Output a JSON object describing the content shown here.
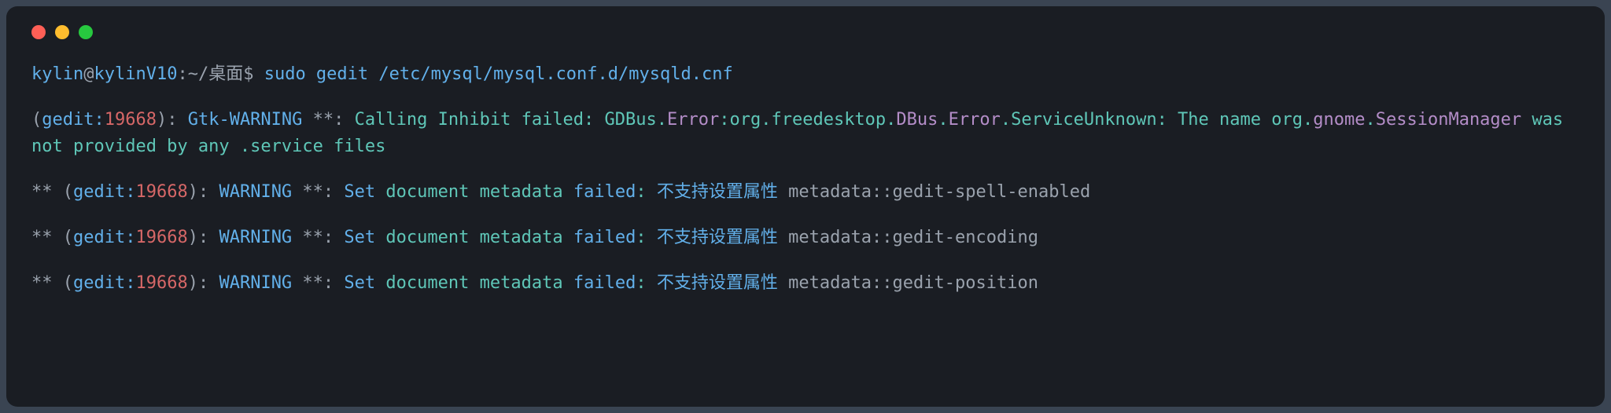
{
  "prompt": {
    "user": "kylin",
    "at": "@",
    "host": "kylinV10",
    "colon": ":",
    "path": "~/桌面",
    "dollar": "$",
    "command": "sudo gedit /etc/mysql/mysql.conf.d/mysqld.cnf"
  },
  "gtk_warning": {
    "open": "(",
    "gedit": "gedit:",
    "pid": "19668",
    "close": "):",
    "type": " Gtk-WARNING",
    "stars": " **: ",
    "msg_a": "Calling Inhibit failed: GDBus.",
    "err1": "Error",
    "msg_b": ":org.freedesktop.",
    "dbus": "DBus",
    "dot1": ".",
    "err2": "Error",
    "msg_c": ".ServiceUnknown: The name org.",
    "gnome": "gnome",
    "dot2": ".",
    "sess": "SessionManager",
    "msg_d": " was not provided by any .service files"
  },
  "warnings": [
    {
      "stars": "** ",
      "open": "(",
      "gedit": "gedit:",
      "pid": "19668",
      "close": "):",
      "type": " WARNING",
      "stars2": " **: ",
      "a": "Set",
      "b": " document metadata ",
      "c": "failed",
      "d": ": ",
      "cn": "不支持设置属性",
      "e": " metadata::gedit-spell-enabled"
    },
    {
      "stars": "** ",
      "open": "(",
      "gedit": "gedit:",
      "pid": "19668",
      "close": "):",
      "type": " WARNING",
      "stars2": " **: ",
      "a": "Set",
      "b": " document metadata ",
      "c": "failed",
      "d": ": ",
      "cn": "不支持设置属性",
      "e": " metadata::gedit-encoding"
    },
    {
      "stars": "** ",
      "open": "(",
      "gedit": "gedit:",
      "pid": "19668",
      "close": "):",
      "type": " WARNING",
      "stars2": " **: ",
      "a": "Set",
      "b": " document metadata ",
      "c": "failed",
      "d": ": ",
      "cn": "不支持设置属性",
      "e": " metadata::gedit-position"
    }
  ]
}
